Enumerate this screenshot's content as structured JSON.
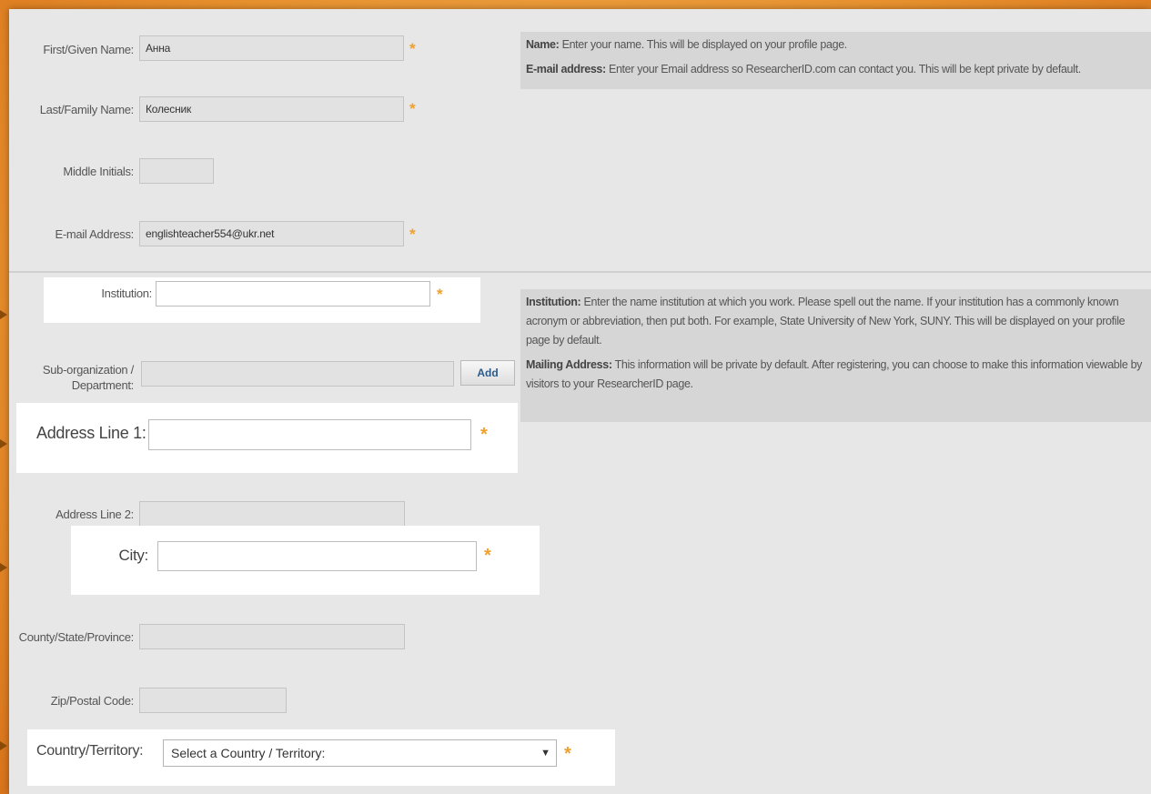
{
  "form": {
    "first_name": {
      "label": "First/Given Name:",
      "value": "Анна"
    },
    "last_name": {
      "label": "Last/Family Name:",
      "value": "Колесник"
    },
    "middle_initials": {
      "label": "Middle Initials:",
      "value": ""
    },
    "email": {
      "label": "E-mail Address:",
      "value": "englishteacher554@ukr.net"
    },
    "institution": {
      "label": "Institution:",
      "value": ""
    },
    "sub_org": {
      "label_line1": "Sub-organization /",
      "label_line2": "Department:",
      "value": "",
      "add_button": "Add"
    },
    "address1": {
      "label": "Address Line 1:",
      "value": ""
    },
    "address2": {
      "label": "Address Line 2:",
      "value": ""
    },
    "city": {
      "label": "City:",
      "value": ""
    },
    "county": {
      "label": "County/State/Province:",
      "value": ""
    },
    "zip": {
      "label": "Zip/Postal Code:",
      "value": ""
    },
    "country": {
      "label": "Country/Territory:",
      "value": "Select a Country / Territory:"
    },
    "required_marker": "*"
  },
  "help": {
    "name_title": "Name:",
    "name_text": "Enter your name. This will be displayed on your profile page.",
    "email_title": "E-mail address:",
    "email_text": "Enter your Email address so ResearcherID.com can contact you. This will be kept private by default.",
    "institution_title": "Institution:",
    "institution_text": "Enter the name institution at which you work. Please spell out the name. If your institution has a commonly known acronym or abbreviation, then put both. For example, State University of New York, SUNY. This will be displayed on your profile page by default.",
    "mailing_title": "Mailing Address:",
    "mailing_text": "This information will be private by default. After registering, you can choose to make this information viewable by visitors to your ResearcherID page."
  },
  "colors": {
    "accent_orange": "#e07f22",
    "required_star": "#f0a030",
    "add_button_text": "#2a5a8c"
  }
}
